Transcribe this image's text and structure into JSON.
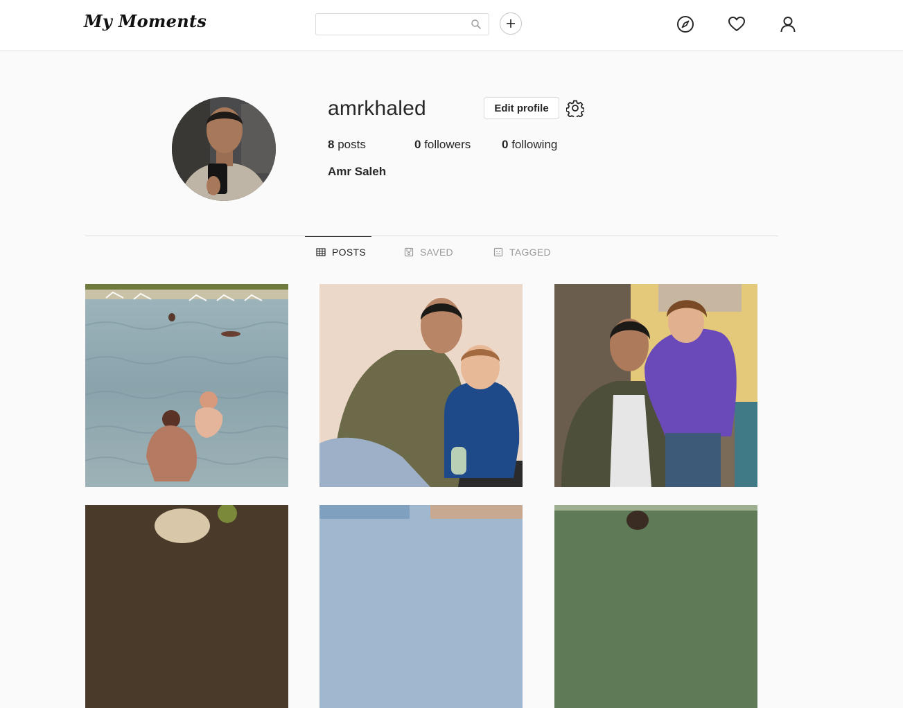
{
  "header": {
    "logo": "My Moments",
    "search_placeholder": "",
    "icons": [
      "search-icon",
      "plus-icon",
      "compass-icon",
      "heart-icon",
      "user-icon"
    ]
  },
  "profile": {
    "username": "amrkhaled",
    "edit_label": "Edit profile",
    "stats": {
      "posts_count": "8",
      "posts_label": "posts",
      "followers_count": "0",
      "followers_label": "followers",
      "following_count": "0",
      "following_label": "following"
    },
    "full_name": "Amr Saleh"
  },
  "tabs": [
    {
      "label": "POSTS",
      "icon": "grid-icon",
      "active": true
    },
    {
      "label": "SAVED",
      "icon": "bookmark-icon",
      "active": false
    },
    {
      "label": "TAGGED",
      "icon": "tag-icon",
      "active": false
    }
  ],
  "posts": [
    {
      "description": "painted pool scene, father holding child in water"
    },
    {
      "description": "man in olive hoodie with toddler in blue jacket"
    },
    {
      "description": "man in green jacket holding child in purple jacket"
    },
    {
      "description": "post 4"
    },
    {
      "description": "post 5"
    },
    {
      "description": "post 6"
    }
  ],
  "colors": {
    "background": "#fafafa",
    "topbar": "#ffffff",
    "border": "#dbdbdb",
    "text": "#262626",
    "muted": "#999999"
  }
}
